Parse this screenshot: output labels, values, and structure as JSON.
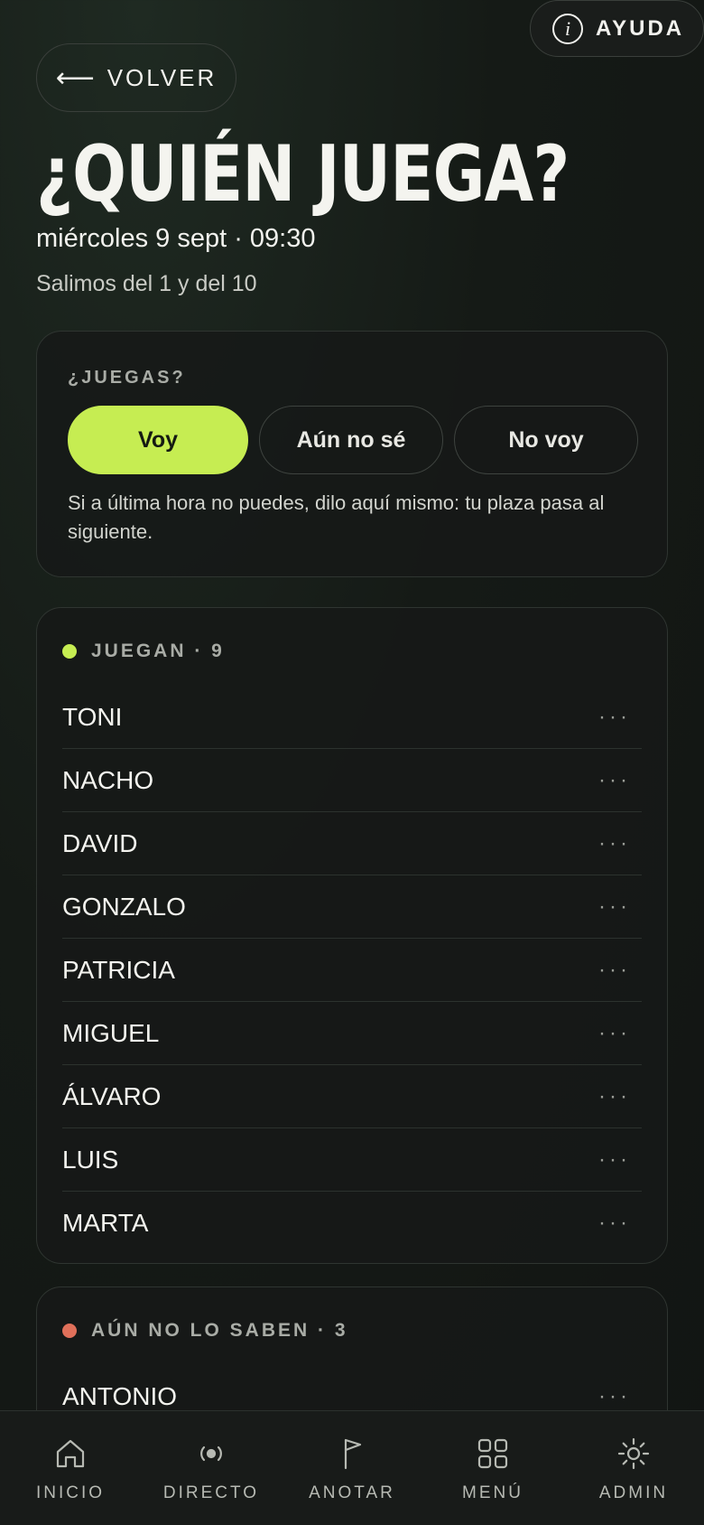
{
  "header": {
    "help_label": "AYUDA",
    "back_label": "VOLVER",
    "title": "¿QUIÉN JUEGA?",
    "date": "miércoles 9 sept · 09:30",
    "subtitle": "Salimos del 1 y del 10"
  },
  "rsvp": {
    "label": "¿JUEGAS?",
    "options": [
      {
        "label": "Voy",
        "selected": true
      },
      {
        "label": "Aún no sé",
        "selected": false
      },
      {
        "label": "No voy",
        "selected": false
      }
    ],
    "note": "Si a última hora no puedes, dilo aquí mismo: tu plaza pasa al siguiente."
  },
  "playing": {
    "heading": "JUEGAN · 9",
    "status_color": "#c6ed52",
    "players": [
      "TONI",
      "NACHO",
      "DAVID",
      "GONZALO",
      "PATRICIA",
      "MIGUEL",
      "ÁLVARO",
      "LUIS",
      "MARTA"
    ]
  },
  "undecided": {
    "heading": "AÚN NO LO SABEN · 3",
    "status_color": "#e0705a",
    "players": [
      "ANTONIO"
    ]
  },
  "more_icon": "···",
  "nav": [
    {
      "label": "INICIO",
      "icon": "home-icon"
    },
    {
      "label": "DIRECTO",
      "icon": "live-icon"
    },
    {
      "label": "ANOTAR",
      "icon": "flag-icon"
    },
    {
      "label": "MENÚ",
      "icon": "grid-icon"
    },
    {
      "label": "ADMIN",
      "icon": "sun-icon"
    }
  ],
  "colors": {
    "accent": "#c6ed52",
    "background": "#151a16"
  }
}
